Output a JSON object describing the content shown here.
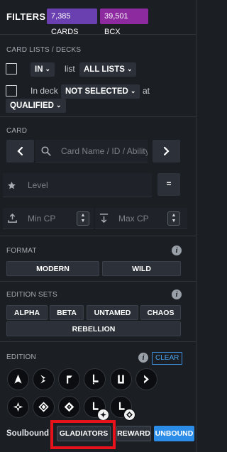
{
  "header": {
    "title": "FILTERS",
    "cards_badge": "7,385 CARDS",
    "bcx_badge": "39,501 BCX"
  },
  "card_lists": {
    "label": "CARD LISTS / DECKS",
    "row1": {
      "in_value": "IN",
      "list_text": "list",
      "list_value": "ALL LISTS"
    },
    "row2": {
      "in_deck_text": "In deck",
      "deck_value": "NOT SELECTED",
      "at_text": "at",
      "format_value": "QUALIFIED"
    }
  },
  "card": {
    "label": "CARD",
    "search_placeholder": "Card Name / ID / Ability",
    "level_placeholder": "Level",
    "level_op": "=",
    "min_cp_placeholder": "Min CP",
    "max_cp_placeholder": "Max CP"
  },
  "format": {
    "label": "FORMAT",
    "options": [
      "MODERN",
      "WILD"
    ]
  },
  "edition_sets": {
    "label": "EDITION SETS",
    "options": [
      "ALPHA",
      "BETA",
      "UNTAMED",
      "CHAOS"
    ],
    "wide_option": "REBELLION"
  },
  "edition": {
    "label": "EDITION",
    "clear_label": "CLEAR",
    "icons": [
      "alpha-edition-icon",
      "beta-edition-icon",
      "promo-edition-icon",
      "reward-edition-icon",
      "untamed-edition-icon",
      "dice-edition-icon",
      "chaos-edition-icon",
      "rift-edition-icon",
      "rebellion-edition-icon",
      "reward-chaos-edition-icon",
      "reward-rebellion-edition-icon"
    ]
  },
  "soulbound": {
    "label": "Soulbound",
    "options": [
      "GLADIATORS",
      "REWARD",
      "UNBOUND"
    ],
    "selected": "UNBOUND"
  },
  "colors": {
    "background": "#1b1e23",
    "cards_badge": "#6a3fb0",
    "bcx_badge": "#8d2aa0",
    "accent_blue": "#2b8de8",
    "highlight_red": "#e8121a"
  }
}
